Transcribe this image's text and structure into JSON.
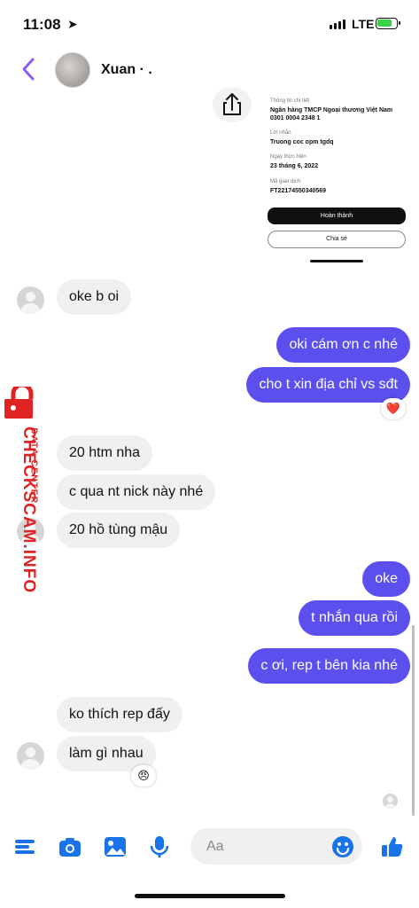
{
  "status_bar": {
    "time": "11:08",
    "network": "LTE",
    "location_icon": "location-arrow-icon",
    "battery": "charging"
  },
  "header": {
    "contact_name": "Xuan · .",
    "back_icon": "chevron-left-icon",
    "accent_color": "#8b5cf6"
  },
  "receipt": {
    "details_label": "Thông tin chi tiết",
    "bank": "Ngân hàng TMCP Ngoại thương Việt Nam",
    "account": "0301 0004 2348 1",
    "message_label": "Lời nhắn",
    "message": "Truong coc opm tgdq",
    "date_label": "Ngày thực hiện",
    "date": "23 tháng 6, 2022",
    "txn_label": "Mã giao dịch",
    "txn": "FT22174550340569",
    "done_button": "Hoàn thành",
    "share_button": "Chia sẻ"
  },
  "messages": [
    {
      "side": "in",
      "text": "oke b oi"
    },
    {
      "side": "out",
      "text": "oki cám ơn c nhé"
    },
    {
      "side": "out",
      "text": "cho t xin địa chỉ vs sđt",
      "reaction": "❤️"
    },
    {
      "side": "in",
      "text": "20 htm nha"
    },
    {
      "side": "in",
      "text": "c qua nt nick này nhé"
    },
    {
      "side": "in",
      "text": "20 hồ tùng mậu"
    },
    {
      "side": "out",
      "text": "oke"
    },
    {
      "side": "out",
      "text": "t nhắn qua rồi"
    },
    {
      "side": "out",
      "text": "c ơi, rep t bên kia nhé"
    },
    {
      "side": "in",
      "text": "ko thích rep đấy"
    },
    {
      "side": "in",
      "text": "làm gì nhau",
      "reaction": "😠"
    }
  ],
  "watermark": {
    "main": "CHECKSCAM.INFO",
    "sub": "DATA CENTER"
  },
  "composer": {
    "placeholder": "Aa"
  },
  "colors": {
    "outgoing_bubble": "#5b50ee",
    "incoming_bubble": "#f0f0f0",
    "toolbar_icons": "#1a73e8"
  }
}
